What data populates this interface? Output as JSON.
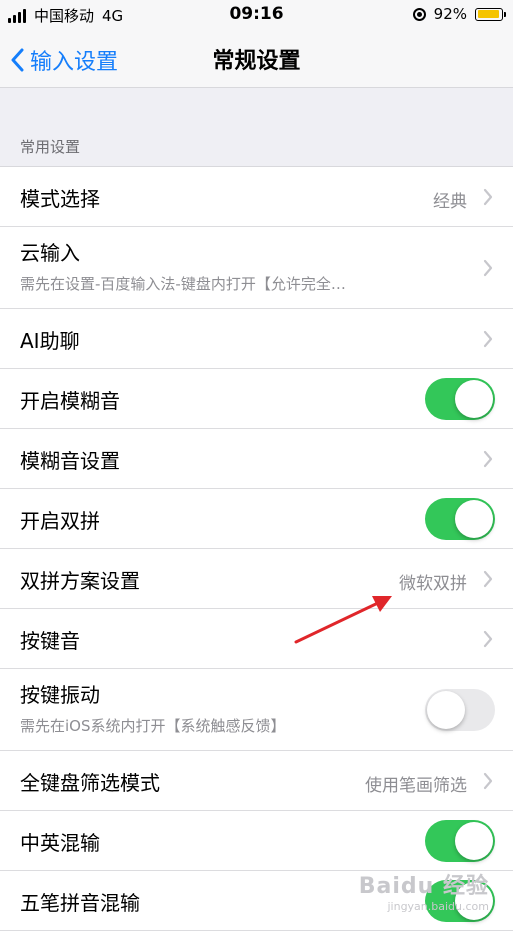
{
  "status_bar": {
    "carrier": "中国移动",
    "network": "4G",
    "time": "09:16",
    "battery": "92%",
    "battery_color": "#f5c400"
  },
  "nav": {
    "back_label": "输入设置",
    "title": "常规设置",
    "accent": "#157efb"
  },
  "section": {
    "header": "常用设置"
  },
  "rows": [
    {
      "title": "模式选择",
      "value": "经典",
      "control": "chevron"
    },
    {
      "title": "云输入",
      "subtitle": "需先在设置-百度输入法-键盘内打开【允许完全…",
      "control": "chevron"
    },
    {
      "title": "AI助聊",
      "control": "chevron"
    },
    {
      "title": "开启模糊音",
      "control": "toggle",
      "on": true
    },
    {
      "title": "模糊音设置",
      "control": "chevron"
    },
    {
      "title": "开启双拼",
      "control": "toggle",
      "on": true
    },
    {
      "title": "双拼方案设置",
      "value": "微软双拼",
      "control": "chevron"
    },
    {
      "title": "按键音",
      "control": "chevron"
    },
    {
      "title": "按键振动",
      "subtitle": "需先在iOS系统内打开【系统触感反馈】",
      "control": "toggle",
      "on": false
    },
    {
      "title": "全键盘筛选模式",
      "value": "使用笔画筛选",
      "control": "chevron"
    },
    {
      "title": "中英混输",
      "control": "toggle",
      "on": true
    },
    {
      "title": "五笔拼音混输",
      "control": "toggle",
      "on": true
    }
  ],
  "toggle_on_color": "#33c759",
  "watermark": {
    "text": "Baidu 经验",
    "sub": "jingyan.baidu.com"
  }
}
